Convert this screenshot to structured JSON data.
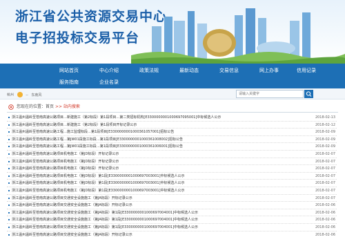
{
  "header": {
    "title_line1": "浙江省公共资源交易中心",
    "title_line2": "电子招投标交易平台"
  },
  "nav": {
    "items": [
      "网站首页",
      "中心介绍",
      "政策法规",
      "最新动态",
      "交易信息",
      "网上办事",
      "信用记录",
      "服务指南",
      "企业名录"
    ]
  },
  "weather": {
    "city": "杭州",
    "temp": "--",
    "desc": "东南风"
  },
  "search": {
    "placeholder": "请输入关键字"
  },
  "breadcrumb": {
    "prefix": "您现在的位置：",
    "home": "首页",
    "sep": " >> ",
    "current": "站内搜索"
  },
  "results": [
    {
      "title": "浙江温州温岭至苍南高速公路项目…新建施工（第2标段）第1段项目…第二类招标机构[E3300000001000697095001]中标候选人公示",
      "date": "2018-02-13"
    },
    {
      "title": "浙江温州温岭至苍南高速公路项目…新建施工（第2标段）第1段项目开标记录公示",
      "date": "2018-02-12"
    },
    {
      "title": "浙江温州温岭至苍南高速公路工程…施工监理标段…第1段项目[E3300000001000361057001]招标公告",
      "date": "2018-02-09"
    },
    {
      "title": "浙江温州温岭至苍南高速公路工程…第JW01段施工标段…第1段项目[E3300000001000361008002]招标公告",
      "date": "2018-02-09"
    },
    {
      "title": "浙江温州温岭至苍南高速公路工程…第JW01段施工标段…第1段项目[E3300000001000361006001]招标公告",
      "date": "2018-02-09"
    },
    {
      "title": "浙江温州温岭至苍南高速公路项目机电施工（第JD标段）开标记录公示",
      "date": "2018-02-07"
    },
    {
      "title": "浙江温州温岭至苍南高速公路项目机电施工（第JD标段）开标记录公示",
      "date": "2018-02-07"
    },
    {
      "title": "浙江温州温岭至苍南高速公路项目机电施工（第JD标段）开标记录公示",
      "date": "2018-02-07"
    },
    {
      "title": "浙江温州温岭至苍南高速公路项目机电施工（第JD标段）第1段[E3300000001000697003001]中标候选人公示",
      "date": "2018-02-07"
    },
    {
      "title": "浙江温州温岭至苍南高速公路项目机电施工（第JD标段）第1段[E3300000001000697003001]中标候选人公示",
      "date": "2018-02-07"
    },
    {
      "title": "浙江温州温岭至苍南高速公路项目机电施工（第JD标段）第1段[E3300000001000697003001]中标候选人公示",
      "date": "2018-02-07"
    },
    {
      "title": "浙江温州温岭至苍南高速公路项目交通安全设施施工（第JA标段）开标记录公示",
      "date": "2018-02-07"
    },
    {
      "title": "浙江温州温岭至苍南高速公路项目交通安全设施施工（第JA标段）开标记录公示",
      "date": "2018-02-06"
    },
    {
      "title": "浙江温州温岭至苍南高速公路项目交通安全设施施工（第JA标段）第1段[E3300000001000697004001]中标候选人公示",
      "date": "2018-02-06"
    },
    {
      "title": "浙江温州温岭至苍南高速公路项目交通安全设施施工（第JA标段）第1段[E3300000001000697004001]中标候选人公示",
      "date": "2018-02-06"
    },
    {
      "title": "浙江温州温岭至苍南高速公路项目交通安全设施施工（第JA标段）第1段[E3300000001000697004001]中标候选人公示",
      "date": "2018-02-06"
    },
    {
      "title": "浙江温州温岭至苍南高速公路项目交通安全设施施工（第JA标段）开标记录公示",
      "date": "2018-02-06"
    }
  ]
}
